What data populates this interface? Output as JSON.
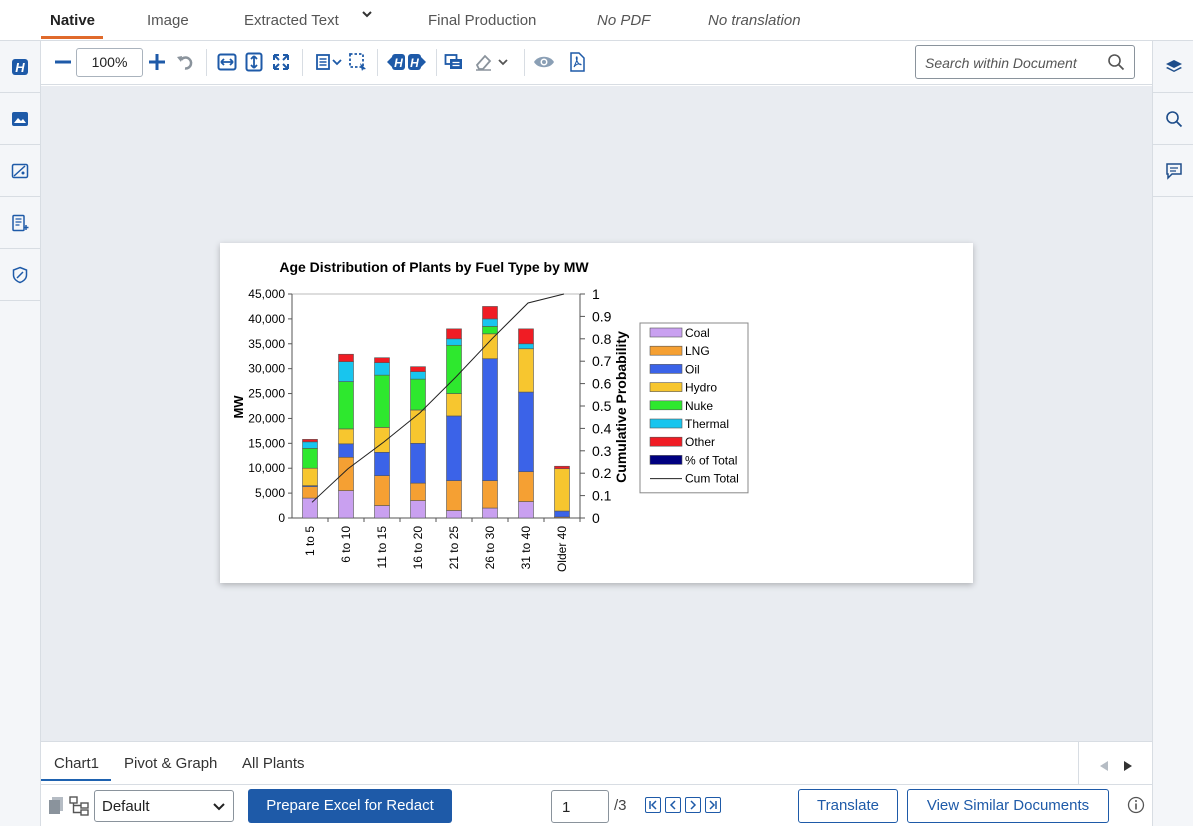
{
  "top_tabs": [
    {
      "label": "Native"
    },
    {
      "label": "Image"
    },
    {
      "label": "Extracted Text"
    },
    {
      "label": "Final Production"
    },
    {
      "label": "No PDF"
    },
    {
      "label": "No translation"
    }
  ],
  "toolbar": {
    "zoom": "100%",
    "search_placeholder": "Search within Document"
  },
  "chart_data": {
    "type": "bar",
    "stacked": true,
    "title": "Age Distribution of Plants by Fuel Type by MW",
    "ylabel": "MW",
    "y2label": "Cumulative Probability",
    "ylim": [
      0,
      45000
    ],
    "y2lim": [
      0,
      1
    ],
    "yticks": [
      "0",
      "5,000",
      "10,000",
      "15,000",
      "20,000",
      "25,000",
      "30,000",
      "35,000",
      "40,000",
      "45,000"
    ],
    "y2ticks": [
      "0",
      "0.1",
      "0.2",
      "0.3",
      "0.4",
      "0.5",
      "0.6",
      "0.7",
      "0.8",
      "0.9",
      "1"
    ],
    "categories": [
      "1 to 5",
      "6 to 10",
      "11 to 15",
      "16 to 20",
      "21 to 25",
      "26 to 30",
      "31 to 40",
      "Older 40"
    ],
    "series": [
      {
        "name": "Coal",
        "color": "#c9a0f0",
        "values": [
          4000,
          5500,
          2500,
          3500,
          1500,
          2000,
          3300,
          0
        ]
      },
      {
        "name": "LNG",
        "color": "#f5a033",
        "values": [
          2300,
          6700,
          6000,
          3500,
          6000,
          5500,
          6000,
          200
        ]
      },
      {
        "name": "Oil",
        "color": "#3b63e8",
        "values": [
          200,
          2700,
          4700,
          8000,
          13000,
          24500,
          16000,
          1200
        ]
      },
      {
        "name": "Hydro",
        "color": "#f7c62f",
        "values": [
          3500,
          3000,
          5000,
          6700,
          4500,
          5000,
          8700,
          8500
        ]
      },
      {
        "name": "Nuke",
        "color": "#2ee82e",
        "values": [
          4000,
          9500,
          10500,
          6200,
          9700,
          1500,
          0,
          0
        ]
      },
      {
        "name": "Thermal",
        "color": "#18c5ee",
        "values": [
          1300,
          4000,
          2500,
          1500,
          1300,
          1500,
          1000,
          0
        ]
      },
      {
        "name": "Other",
        "color": "#f01c24",
        "values": [
          500,
          1500,
          1000,
          1000,
          2000,
          2500,
          3000,
          500
        ]
      },
      {
        "name": "% of Total",
        "color": "#000080",
        "values": [
          0,
          0,
          0,
          0,
          0,
          0,
          0,
          0
        ]
      }
    ],
    "line_series": {
      "name": "Cum Total",
      "axis": "right",
      "values": [
        0.07,
        0.22,
        0.34,
        0.47,
        0.63,
        0.8,
        0.96,
        1.0
      ]
    },
    "legend": "right"
  },
  "sheet_tabs": [
    {
      "label": "Chart1"
    },
    {
      "label": "Pivot & Graph"
    },
    {
      "label": "All Plants"
    }
  ],
  "bottom": {
    "select_value": "Default",
    "prepare_label": "Prepare Excel for Redact",
    "page_value": "1",
    "page_total": "/3",
    "translate_label": "Translate",
    "similar_label": "View Similar Documents"
  },
  "colors": {
    "accent": "#e06a2b",
    "primary": "#1e5aa8",
    "icon": "#1e5aa8"
  }
}
